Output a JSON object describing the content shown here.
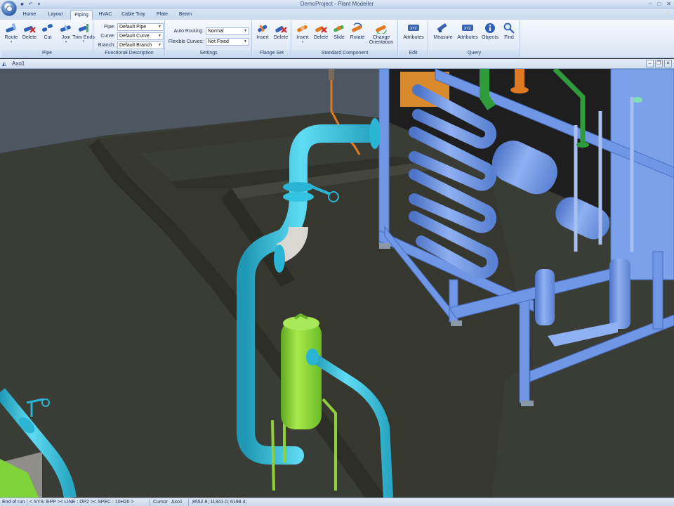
{
  "window": {
    "title": "DemoProject - Plant Modeller"
  },
  "ribbon_tabs": [
    "Home",
    "Layout",
    "Piping",
    "HVAC",
    "Cable Tray",
    "Plate",
    "Beam"
  ],
  "active_tab": "Piping",
  "groups": {
    "pipe": {
      "label": "Pipe",
      "buttons": [
        "Route",
        "Delete",
        "Cut",
        "Join",
        "Trim Ends"
      ]
    },
    "functional": {
      "label": "Functional Description",
      "fields": [
        {
          "label": "Pipe:",
          "value": "Default Pipe"
        },
        {
          "label": "Curve:",
          "value": "Default Curve"
        },
        {
          "label": "Branch:",
          "value": "Default Branch"
        }
      ]
    },
    "settings": {
      "label": "Settings",
      "fields": [
        {
          "label": "Auto Routing:",
          "value": "Normal"
        },
        {
          "label": "Flexible Curves:",
          "value": "Not Fixed"
        }
      ]
    },
    "flange_set": {
      "label": "Flange Set",
      "buttons": [
        "Insert",
        "Delete"
      ]
    },
    "standard_component": {
      "label": "Standard Component",
      "buttons": [
        "Insert",
        "Delete",
        "Slide",
        "Rotate",
        "Change Orientation"
      ]
    },
    "edit": {
      "label": "Edit",
      "buttons": [
        "Attributes"
      ]
    },
    "query": {
      "label": "Query",
      "buttons": [
        "Measure",
        "Attributes",
        "Objects",
        "Find"
      ]
    }
  },
  "document": {
    "title": "Axo1"
  },
  "status": {
    "state": "End of run",
    "spec": "< SYS: EPP >< LINE : DP2 >< SPEC : 10H20 >",
    "cursor_label": "Cursor",
    "cursor_view": "Axo1",
    "coordinates": "8552.8; 11341.0; 6198.4;"
  },
  "colors": {
    "floor": "#3a3c36",
    "wall": "#4b5560",
    "pipe_cyan": "#3fc6e2",
    "structure_blue": "#6f97e6",
    "vessel_green": "#8ed13a",
    "pipe_orange": "#e07a22",
    "pipe_green": "#2f9b3a",
    "elbow_gray": "#d8d8d0"
  }
}
